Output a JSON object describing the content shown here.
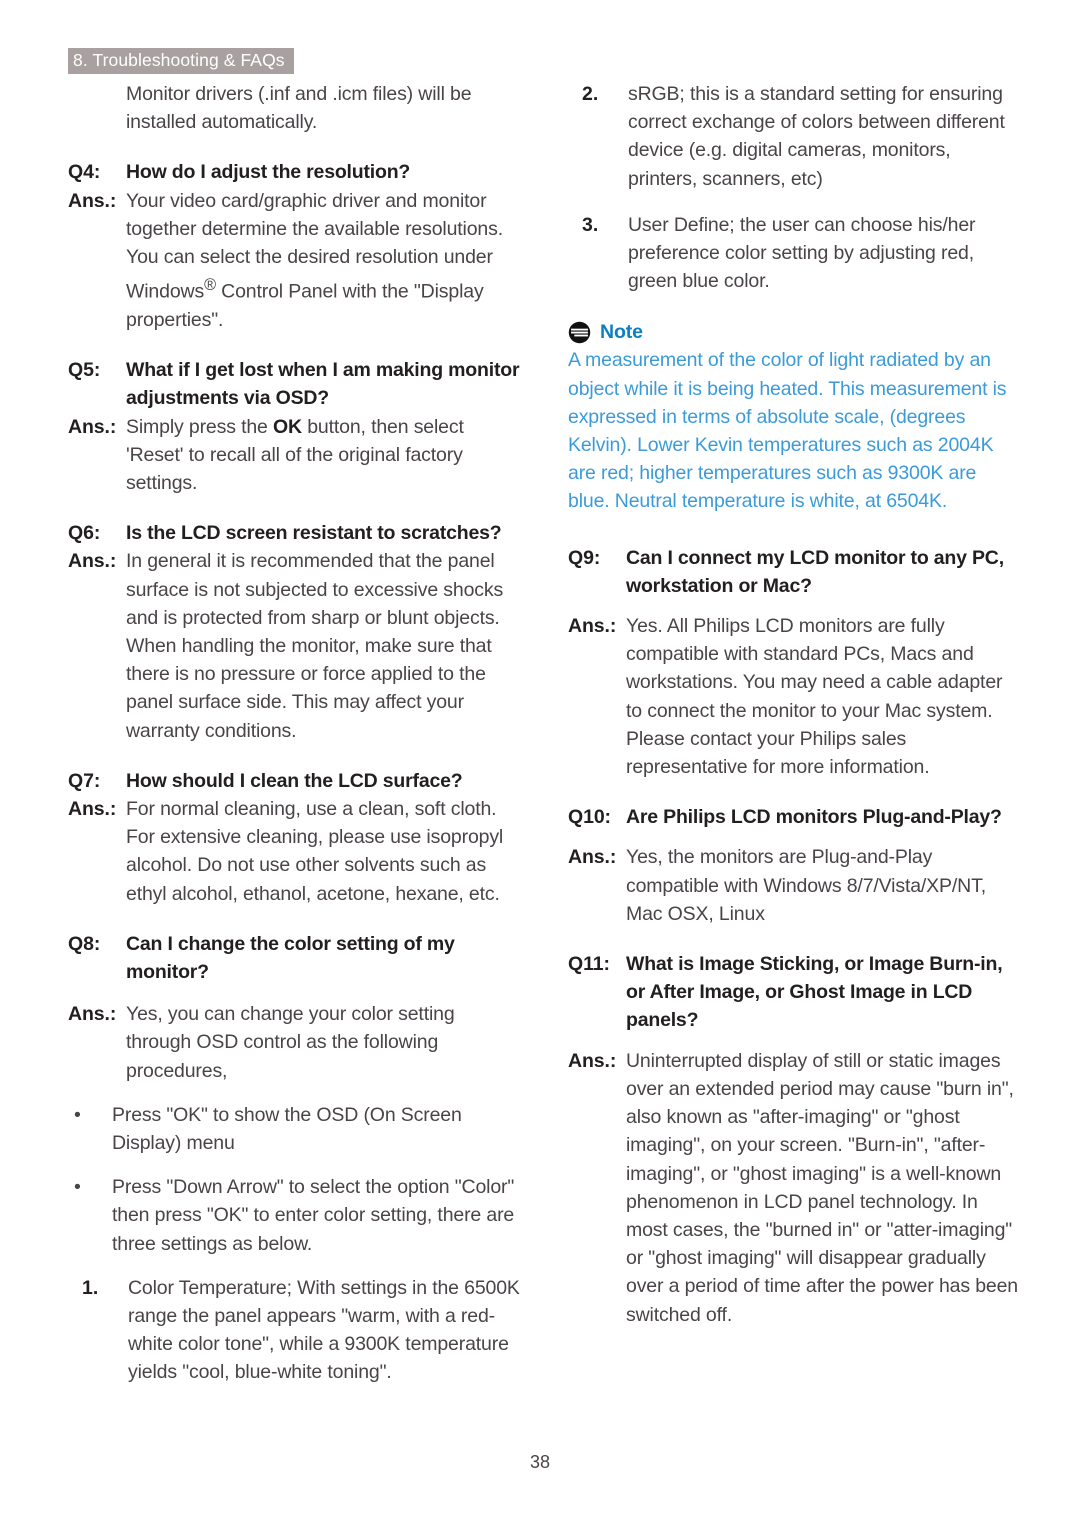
{
  "document": {
    "running_head": "8. Troubleshooting & FAQs",
    "page_number": "38"
  },
  "left_column": {
    "intro_paragraph": "Monitor drivers (.inf and .icm files) will be installed automatically.",
    "faqs": [
      {
        "q_label": "Q4:",
        "question": "How do I adjust the resolution?",
        "a_label": "Ans.:",
        "answer_pre": "Your video card/graphic driver and monitor together determine the available resolutions. You can select the desired resolution under Windows",
        "answer_sup": "®",
        "answer_post": " Control Panel with the \"Display properties\"."
      },
      {
        "q_label": "Q5:",
        "question": "What if I get lost when I am making monitor adjustments via OSD?",
        "a_label": "Ans.:",
        "answer_pre": "Simply press the ",
        "answer_bold": "OK",
        "answer_post": " button, then select 'Reset' to recall all of the original factory settings."
      },
      {
        "q_label": "Q6:",
        "question": "Is the LCD screen resistant to scratches?",
        "a_label": "Ans.:",
        "answer": "In general it is recommended that the panel surface is not subjected to excessive shocks and is protected from sharp or blunt objects. When handling the monitor, make sure that there is no pressure or force applied to the panel surface side. This may affect your warranty conditions."
      },
      {
        "q_label": "Q7:",
        "question": "How should I clean the LCD surface?",
        "a_label": "Ans.:",
        "answer": "For normal cleaning, use a clean, soft cloth. For extensive cleaning, please use isopropyl alcohol. Do not use other solvents such as ethyl alcohol, ethanol, acetone, hexane, etc."
      },
      {
        "q_label": "Q8:",
        "question": "Can I change the color setting of my monitor?",
        "a_label": "Ans.:",
        "answer": "Yes, you can change your color setting through OSD control as the following procedures,"
      }
    ],
    "bullets": [
      {
        "marker": "•",
        "text": "Press \"OK\" to show the OSD (On Screen Display) menu"
      },
      {
        "marker": "•",
        "text": "Press \"Down Arrow\" to select the option \"Color\" then press \"OK\" to enter color setting, there are three settings as below."
      }
    ],
    "numbered": [
      {
        "marker": "1.",
        "text": "Color Temperature; With settings in the 6500K range the panel appears \"warm, with a red-white color tone\", while a 9300K temperature yields \"cool, blue-white toning\"."
      }
    ]
  },
  "right_column": {
    "numbered": [
      {
        "marker": "2.",
        "text": "sRGB; this is a standard setting for ensuring correct exchange of colors between different device (e.g. digital cameras, monitors, printers, scanners, etc)"
      },
      {
        "marker": "3.",
        "text": "User Define; the user can choose his/her preference color setting by adjusting red, green blue color."
      }
    ],
    "note": {
      "icon": "note-circle-icon",
      "title": "Note",
      "body": "A measurement of the color of light radiated by an object while it is being heated. This measurement is expressed in terms of absolute scale, (degrees Kelvin). Lower Kevin temperatures such as 2004K are red; higher temperatures such as 9300K are blue. Neutral temperature is white, at 6504K.",
      "title_color": "#0b7fc4",
      "body_color": "#3b9bd9"
    },
    "faqs": [
      {
        "q_label": "Q9:",
        "question": "Can I connect my LCD monitor to any PC, workstation or Mac?",
        "a_label": "Ans.:",
        "answer": "Yes. All Philips LCD monitors are fully compatible with standard PCs, Macs and workstations. You may need a cable adapter to connect the monitor to your Mac system. Please contact your Philips sales representative for more information."
      },
      {
        "q_label": "Q10:",
        "question": "Are Philips LCD monitors Plug-and-Play?",
        "a_label": "Ans.:",
        "answer": "Yes, the monitors are Plug-and-Play compatible with Windows 8/7/Vista/XP/NT, Mac OSX, Linux"
      },
      {
        "q_label": "Q11:",
        "question": "What is Image Sticking, or Image Burn-in, or After Image, or Ghost Image in LCD panels?",
        "a_label": "Ans.:",
        "answer": "Uninterrupted display of still or static images over an extended period may cause \"burn in\", also known as \"after-imaging\" or \"ghost imaging\", on your screen. \"Burn-in\", \"after-imaging\", or \"ghost imaging\" is a well-known phenomenon in LCD panel technology. In most cases, the \"burned in\" or \"atter-imaging\" or \"ghost imaging\" will disappear gradually over a period of time after the power has been switched off."
      }
    ]
  },
  "colors": {
    "running_head_bg": "#a9a0a0",
    "running_head_text": "#ffffff",
    "body_text": "#4a4449",
    "heading_text": "#231f20"
  }
}
